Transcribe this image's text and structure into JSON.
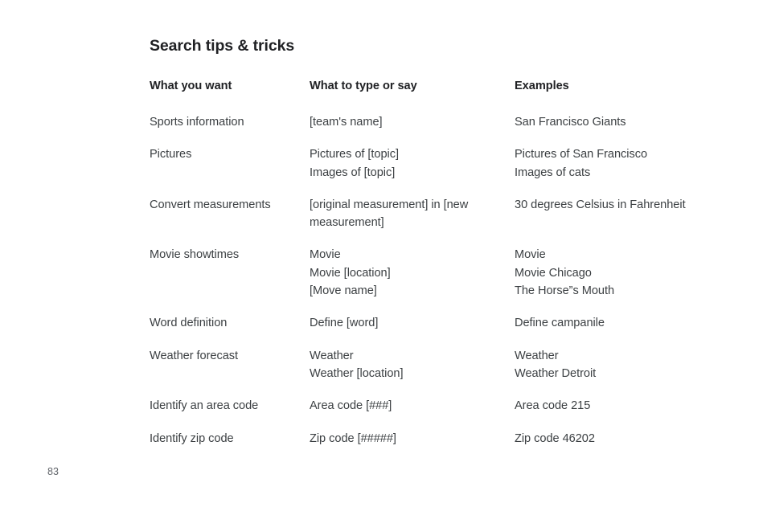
{
  "page": {
    "title": "Search tips & tricks",
    "page_number": "83",
    "background_color": "#ffffff",
    "title_color": "#202124",
    "body_text_color": "#3c4043",
    "page_number_color": "#5f6368"
  },
  "table": {
    "headers": [
      "What you want",
      "What to type or say",
      "Examples"
    ],
    "rows": [
      {
        "want": [
          "Sports information"
        ],
        "type_or_say": [
          "[team's name]"
        ],
        "examples": [
          "San Francisco Giants"
        ]
      },
      {
        "want": [
          "Pictures"
        ],
        "type_or_say": [
          "Pictures of [topic]",
          "Images of [topic]"
        ],
        "examples": [
          "Pictures of San Francisco",
          "Images of cats"
        ]
      },
      {
        "want": [
          "Convert measurements"
        ],
        "type_or_say": [
          "[original measurement] in [new measurement]"
        ],
        "examples": [
          "30 degrees Celsius in Fahrenheit"
        ]
      },
      {
        "want": [
          "Movie showtimes"
        ],
        "type_or_say": [
          "Movie",
          "Movie [location]",
          "[Move name]"
        ],
        "examples": [
          "Movie",
          "Movie Chicago",
          "The Horse”s Mouth"
        ]
      },
      {
        "want": [
          "Word definition"
        ],
        "type_or_say": [
          "Define [word]"
        ],
        "examples": [
          "Define campanile"
        ]
      },
      {
        "want": [
          "Weather forecast"
        ],
        "type_or_say": [
          "Weather",
          "Weather [location]"
        ],
        "examples": [
          "Weather",
          "Weather Detroit"
        ]
      },
      {
        "want": [
          "Identify an area code"
        ],
        "type_or_say": [
          "Area code [###]"
        ],
        "examples": [
          "Area code 215"
        ]
      },
      {
        "want": [
          "Identify zip code"
        ],
        "type_or_say": [
          "Zip code [#####]"
        ],
        "examples": [
          "Zip code 46202"
        ]
      }
    ]
  }
}
